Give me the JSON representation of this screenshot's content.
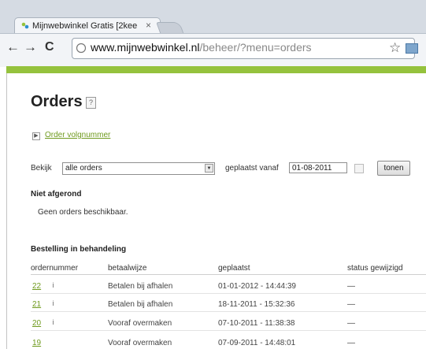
{
  "browser": {
    "tab_title": "Mijnwebwinkel Gratis [2kee",
    "tab_close": "×",
    "url_host": "www.mijnwebwinkel.nl",
    "url_path": "/beheer/?menu=orders"
  },
  "page": {
    "title": "Orders",
    "help": "?",
    "toggle_link": "Order volgnummer",
    "filter_label": "Bekijk",
    "filter_value": "alle orders",
    "date_label": "geplaatst vanaf",
    "date_value": "01-08-2011",
    "show_button": "tonen",
    "section_unfinished": "Niet afgerond",
    "empty_message": "Geen orders beschikbaar.",
    "section_processing": "Bestelling in behandeling",
    "columns": [
      "ordernummer",
      "betaalwijze",
      "geplaatst",
      "status gewijzigd"
    ],
    "rows": [
      {
        "number": "22",
        "payment": "Betalen bij afhalen",
        "placed": "01-01-2012 - 14:44:39",
        "status": "—"
      },
      {
        "number": "21",
        "payment": "Betalen bij afhalen",
        "placed": "18-11-2011 - 15:32:36",
        "status": "—"
      },
      {
        "number": "20",
        "payment": "Vooraf overmaken",
        "placed": "07-10-2011 - 11:38:38",
        "status": "—"
      },
      {
        "number": "19",
        "payment": "Vooraf overmaken",
        "placed": "07-09-2011 - 14:48:01",
        "status": "—"
      }
    ]
  },
  "icons": {
    "back": "←",
    "forward": "→",
    "reload": "C",
    "star": "☆",
    "info": "i"
  }
}
